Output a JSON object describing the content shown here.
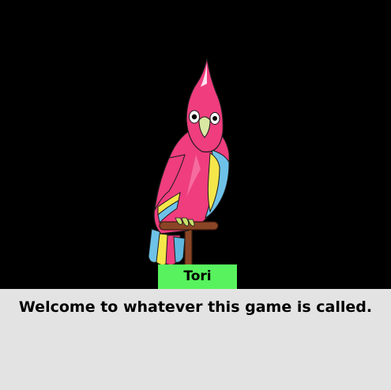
{
  "character": {
    "name": "Tori",
    "icon": "parrot-on-perch",
    "nameplate_color": "#57f25e"
  },
  "dialogue": {
    "text": "Welcome to whatever this game is called.",
    "background_color": "#e3e3e3"
  },
  "scene": {
    "background_color": "#000000"
  }
}
